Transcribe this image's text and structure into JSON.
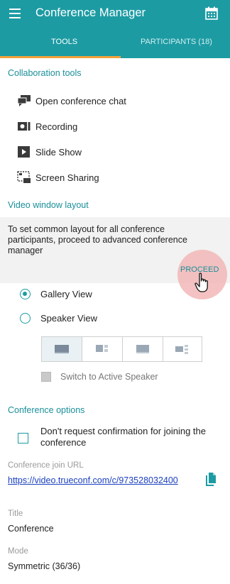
{
  "header": {
    "title": "Conference Manager",
    "accent": "#1d9ba3"
  },
  "tabs": [
    {
      "label": "TOOLS",
      "active": true
    },
    {
      "label": "PARTICIPANTS (18)",
      "active": false
    }
  ],
  "collaboration": {
    "title": "Collaboration tools",
    "items": [
      {
        "label": "Open conference chat",
        "icon": "chat-icon"
      },
      {
        "label": "Recording",
        "icon": "record-icon"
      },
      {
        "label": "Slide Show",
        "icon": "slideshow-icon"
      },
      {
        "label": "Screen Sharing",
        "icon": "screen-share-icon"
      }
    ]
  },
  "video_layout": {
    "title": "Video window layout",
    "info": "To set common layout for all conference participants, proceed to advanced conference manager",
    "proceed_label": "PROCEED",
    "options": [
      {
        "label": "Gallery View",
        "selected": true
      },
      {
        "label": "Speaker View",
        "selected": false
      }
    ],
    "layout_buttons": [
      "layout-grid-icon",
      "layout-side-icon",
      "layout-full-icon",
      "layout-corner-icon"
    ],
    "switch_label": "Switch to Active Speaker"
  },
  "conference_options": {
    "title": "Conference options",
    "confirm_label": "Don't request confirmation for joining the conference",
    "join_url_label": "Conference join URL",
    "join_url": "https://video.trueconf.com/c/973528032400",
    "title_label": "Title",
    "title_value": "Conference",
    "mode_label": "Mode",
    "mode_value": "Symmetric (36/36)"
  }
}
